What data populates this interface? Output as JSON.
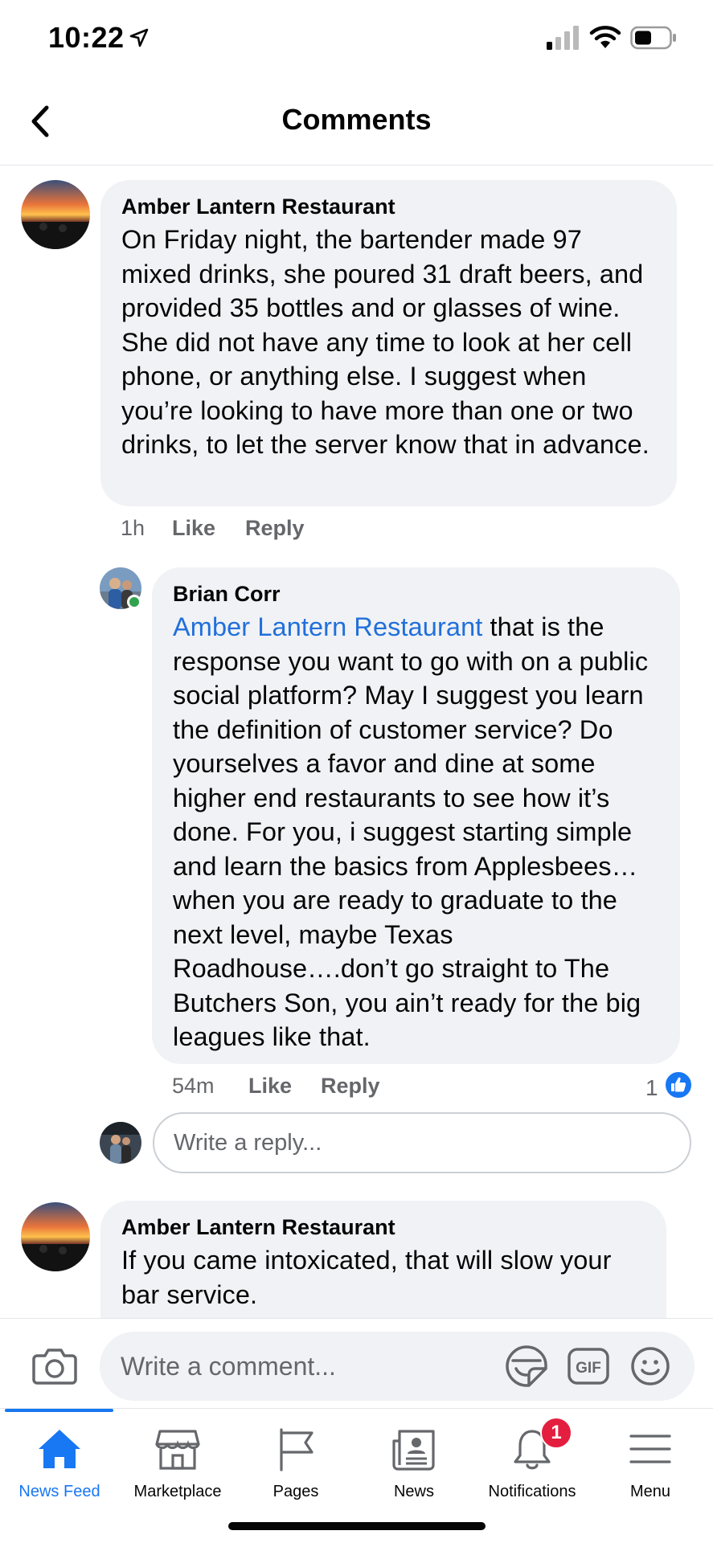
{
  "status_bar": {
    "time": "10:22"
  },
  "header": {
    "title": "Comments"
  },
  "comments": [
    {
      "author": "Amber Lantern Restaurant",
      "text": "On Friday night, the bartender made 97 mixed drinks, she poured 31 draft beers, and provided 35 bottles and or glasses of wine. She did not have any time to look at her cell phone, or anything else. I suggest when you’re looking to have more than one or two drinks, to let the server know that in advance.",
      "time": "1h",
      "like_label": "Like",
      "reply_label": "Reply"
    },
    {
      "author": "Brian Corr",
      "mention": "Amber Lantern Restaurant",
      "text": " that is the response you want to go with on a public social platform?  May I suggest you learn the definition of customer service?   Do yourselves a favor and dine at some higher end restaurants to see how it’s done.  For you, i suggest starting simple and learn the basics from Applesbees…when you are ready to graduate to the next level, maybe Texas Roadhouse….don’t go straight to The Butchers Son, you ain’t ready for the big leagues like that.",
      "time": "54m",
      "like_label": "Like",
      "reply_label": "Reply",
      "reactions": "1"
    },
    {
      "author": "Amber Lantern Restaurant",
      "text": "If you came intoxicated, that will slow your bar service."
    }
  ],
  "reply_box": {
    "placeholder": "Write a reply..."
  },
  "composer": {
    "placeholder": "Write a comment..."
  },
  "tabbar": {
    "items": [
      {
        "label": "News Feed",
        "icon": "home-icon",
        "active": true
      },
      {
        "label": "Marketplace",
        "icon": "marketplace-icon"
      },
      {
        "label": "Pages",
        "icon": "flag-icon"
      },
      {
        "label": "News",
        "icon": "news-icon"
      },
      {
        "label": "Notifications",
        "icon": "bell-icon",
        "badge": "1"
      },
      {
        "label": "Menu",
        "icon": "hamburger-icon"
      }
    ]
  },
  "colors": {
    "accent": "#1877f2",
    "mention": "#216fdb",
    "bubble": "#f0f2f5",
    "badge": "#e41e3f",
    "online": "#31a24c"
  }
}
